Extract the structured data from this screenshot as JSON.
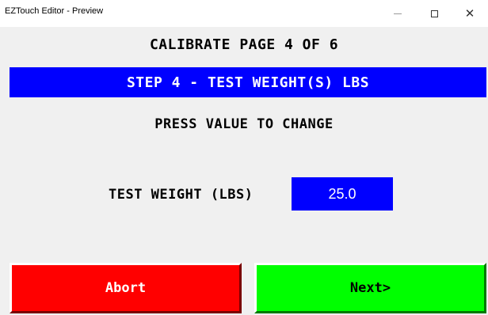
{
  "window": {
    "title": "EZTouch Editor - Preview",
    "minimize_icon": "minimize-icon",
    "maximize_icon": "maximize-icon",
    "close_glyph": "✕"
  },
  "screen": {
    "page_title": "CALIBRATE PAGE 4 OF 6",
    "step_banner": "STEP 4 - TEST WEIGHT(S) LBS",
    "instruction": "PRESS VALUE TO CHANGE",
    "field_label": "TEST WEIGHT (LBS)",
    "field_value": "25.0"
  },
  "buttons": {
    "abort_label": "Abort",
    "next_label": "Next>"
  },
  "colors": {
    "banner": "#0000ff",
    "value_box": "#0000ff",
    "abort": "#ff0000",
    "next": "#00ff00"
  }
}
